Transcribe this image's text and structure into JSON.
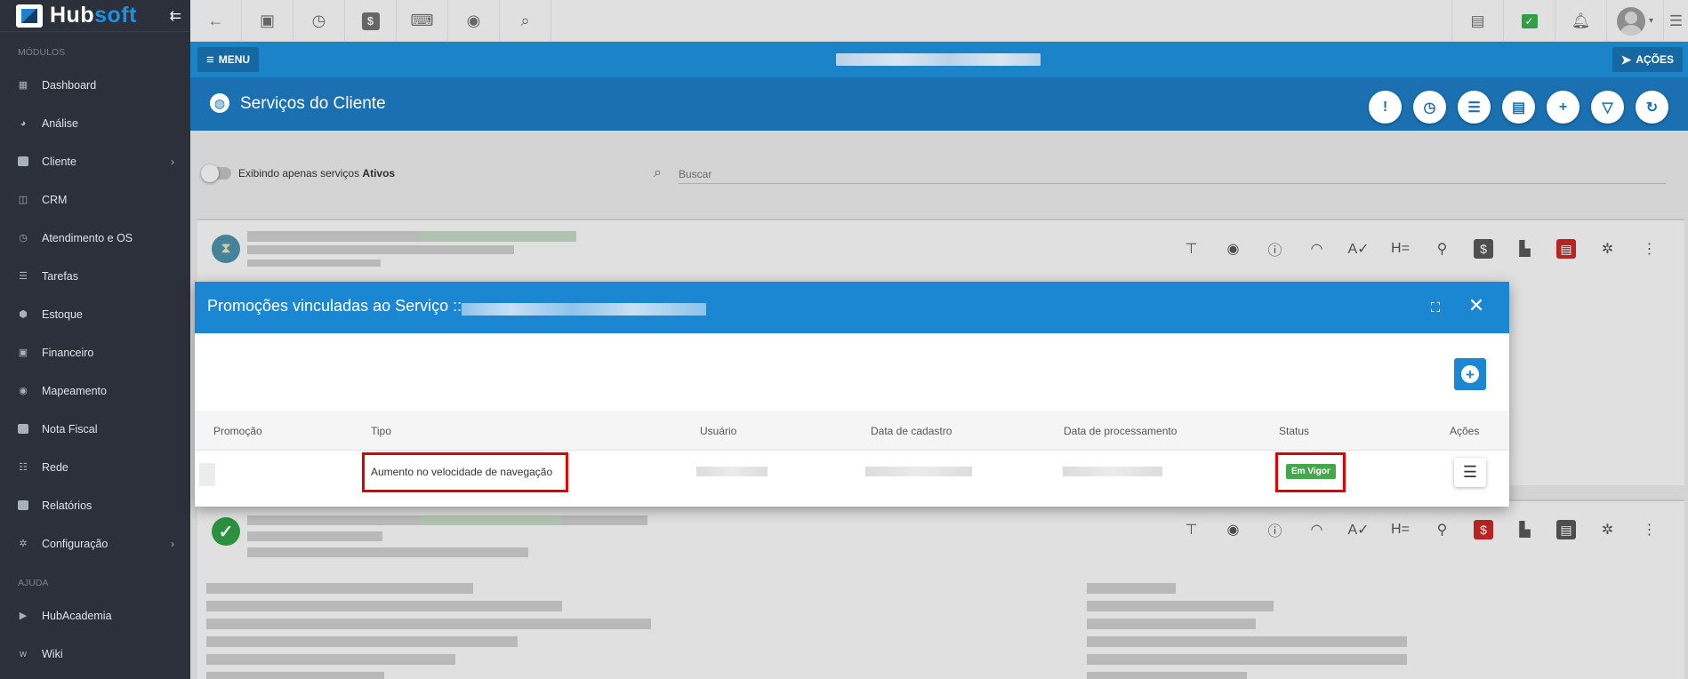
{
  "app": {
    "brand_a": "Hub",
    "brand_b": "soft"
  },
  "sidebar": {
    "section_modulos": "MÓDULOS",
    "section_ajuda": "AJUDA",
    "items": [
      {
        "label": "Dashboard",
        "icon": "dashboard-icon"
      },
      {
        "label": "Análise",
        "icon": "pie-chart-icon"
      },
      {
        "label": "Cliente",
        "icon": "client-icon",
        "has_submenu": true
      },
      {
        "label": "CRM",
        "icon": "crm-icon"
      },
      {
        "label": "Atendimento e OS",
        "icon": "calendar-clock-icon"
      },
      {
        "label": "Tarefas",
        "icon": "tasks-icon"
      },
      {
        "label": "Estoque",
        "icon": "box-icon"
      },
      {
        "label": "Financeiro",
        "icon": "money-icon"
      },
      {
        "label": "Mapeamento",
        "icon": "map-pin-icon"
      },
      {
        "label": "Nota Fiscal",
        "icon": "invoice-icon"
      },
      {
        "label": "Rede",
        "icon": "network-icon"
      },
      {
        "label": "Relatórios",
        "icon": "report-icon"
      },
      {
        "label": "Configuração",
        "icon": "gear-icon",
        "has_submenu": true
      }
    ],
    "help_items": [
      {
        "label": "HubAcademia",
        "icon": "video-icon"
      },
      {
        "label": "Wiki",
        "icon": "wiki-icon"
      }
    ]
  },
  "topbar": {
    "left_icons": [
      "back-arrow-icon",
      "contact-card-icon",
      "calendar-clock-icon",
      "dollar-icon",
      "terminal-icon",
      "eye-icon",
      "search-icon"
    ],
    "right_icons": [
      "pdf-icon",
      "check-icon",
      "bell-icon",
      "avatar",
      "menu-list-icon"
    ]
  },
  "menubar": {
    "menu_label": "MENU",
    "actions_label": "AÇÕES"
  },
  "page": {
    "title": "Serviços do Cliente"
  },
  "filter": {
    "toggle_text": "Exibindo apenas serviços",
    "toggle_bold": "Ativos",
    "search_placeholder": "Buscar"
  },
  "modal": {
    "title": "Promoções vinculadas ao Serviço ::",
    "columns": [
      "Promoção",
      "Tipo",
      "Usuário",
      "Data de cadastro",
      "Data de processamento",
      "Status",
      "Ações"
    ],
    "row": {
      "tipo": "Aumento no velocidade de navegação",
      "status": "Em Vigor"
    }
  },
  "colors": {
    "sidebar_bg": "#2b303b",
    "header_blue": "#1b83c7",
    "title_blue": "#1a70b0",
    "modal_head": "#1b87d2",
    "status_green": "#44a84a",
    "highlight_red": "#e00000"
  }
}
